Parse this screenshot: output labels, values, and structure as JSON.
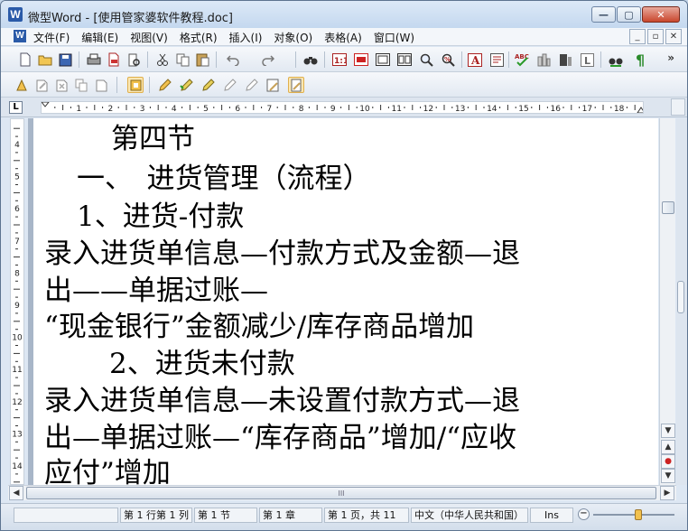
{
  "window": {
    "title": "微型Word - [使用管家婆软件教程.doc]",
    "app_icon_letter": "W"
  },
  "menubar": {
    "items": [
      "文件(F)",
      "编辑(E)",
      "视图(V)",
      "格式(R)",
      "插入(I)",
      "对象(O)",
      "表格(A)",
      "窗口(W)"
    ],
    "mdi_buttons": [
      "_",
      "▫",
      "✕"
    ]
  },
  "ruler": {
    "corner_label": "L",
    "numbers": [
      "1",
      "2",
      "3",
      "4",
      "5",
      "6",
      "7",
      "8",
      "9",
      "10",
      "11",
      "12",
      "13",
      "14",
      "15",
      "16",
      "17",
      "18"
    ]
  },
  "vruler": {
    "numbers": [
      "4",
      "5",
      "6",
      "7",
      "8",
      "9",
      "10",
      "11",
      "12",
      "13",
      "14"
    ]
  },
  "document": {
    "lines": [
      "第四节",
      "一、　进货管理（流程）",
      "1、进货-付款",
      "录入进货单信息—付款方式及金额—退",
      "出——单据过账—",
      "“现金银行”金额减少/库存商品增加",
      "2、进货未付款",
      "录入进货单信息—未设置付款方式—退",
      "出—单据过账—“库存商品”增加/“应收",
      "应付”增加"
    ]
  },
  "hscroll": {
    "thumb_grip": "III"
  },
  "statusbar": {
    "cells": [
      "第 1 行第 1 列",
      "第 1 节",
      "第 1 章",
      "第 1 页，共 11",
      "中文（中华人民共和国）",
      "Ins"
    ],
    "zoom_minus": "−"
  },
  "colors": {
    "accent": "#2a5aa8",
    "close": "#c9472d"
  }
}
